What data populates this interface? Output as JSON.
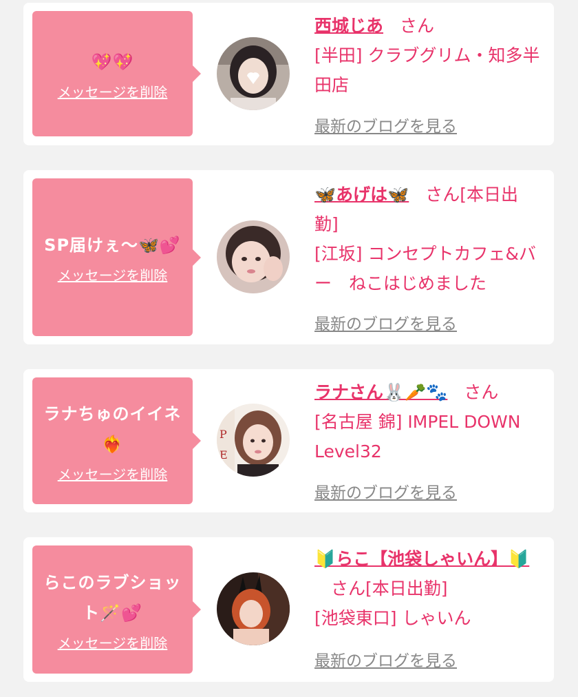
{
  "colors": {
    "page_bg": "#f2f2f2",
    "card_bg": "#ffffff",
    "bubble_bg": "#f58c9e",
    "accent": "#e8336a",
    "link_gray": "#888888"
  },
  "cards": [
    {
      "message": "💖💖",
      "delete_label": "メッセージを削除",
      "name": "西城じあ",
      "san": "さん",
      "status": "",
      "shop": "[半田] クラブグリム・知多半田店",
      "blog_label": "最新のブログを見る"
    },
    {
      "message": "SP届けぇ〜🦋💕",
      "delete_label": "メッセージを削除",
      "name": "🦋あげは🦋",
      "san": "さん",
      "status": "[本日出勤]",
      "shop": "[江坂] コンセプトカフェ&バー　ねこはじめました",
      "blog_label": "最新のブログを見る"
    },
    {
      "message": "ラナちゅのイイネ❤️‍🔥",
      "delete_label": "メッセージを削除",
      "name": "ラナさん🐰🥕🐾",
      "san": "さん",
      "status": "",
      "shop": "[名古屋 錦] IMPEL DOWN Level32",
      "blog_label": "最新のブログを見る"
    },
    {
      "message": "らこのラブショット🪄💕",
      "delete_label": "メッセージを削除",
      "name": "🔰らこ【池袋しゃいん】🔰",
      "san": "さん",
      "status": "[本日出勤]",
      "shop": "[池袋東口] しゃいん",
      "blog_label": "最新のブログを見る"
    }
  ]
}
